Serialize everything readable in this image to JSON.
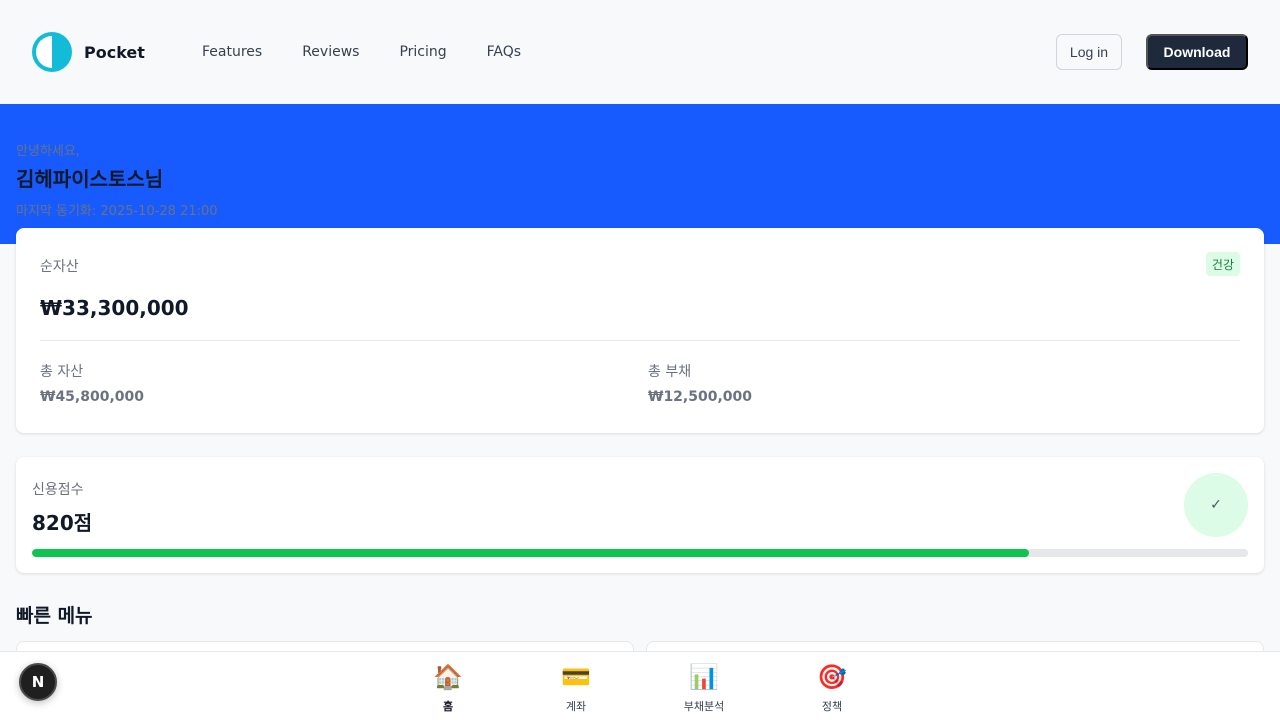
{
  "header": {
    "brand": "Pocket",
    "nav": [
      "Features",
      "Reviews",
      "Pricing",
      "FAQs"
    ],
    "login_label": "Log in",
    "download_label": "Download",
    "accent_color": "#175bff"
  },
  "hero": {
    "greeting": "안녕하세요,",
    "username": "김헤파이스토스님",
    "last_sync": "마지막 동기화: 2025-10-28 21:00"
  },
  "net_worth": {
    "label": "순자산",
    "status_badge": "건강",
    "value": "₩33,300,000",
    "total_assets_label": "총 자산",
    "total_assets_value": "₩45,800,000",
    "total_liabilities_label": "총 부채",
    "total_liabilities_value": "₩12,500,000"
  },
  "credit": {
    "label": "신용점수",
    "score": "820점",
    "check_glyph": "✓",
    "progress_fraction": 0.82
  },
  "quick_menu": {
    "title": "빠른 메뉴"
  },
  "bottom_nav": [
    {
      "icon": "🏠",
      "icon_name": "home-icon",
      "label": "홈",
      "active": true
    },
    {
      "icon": "💳",
      "icon_name": "credit-card-icon",
      "label": "계좌",
      "active": false
    },
    {
      "icon": "📊",
      "icon_name": "bar-chart-icon",
      "label": "부채분석",
      "active": false
    },
    {
      "icon": "🎯",
      "icon_name": "target-icon",
      "label": "정책",
      "active": false
    }
  ],
  "floating_badge": "N"
}
